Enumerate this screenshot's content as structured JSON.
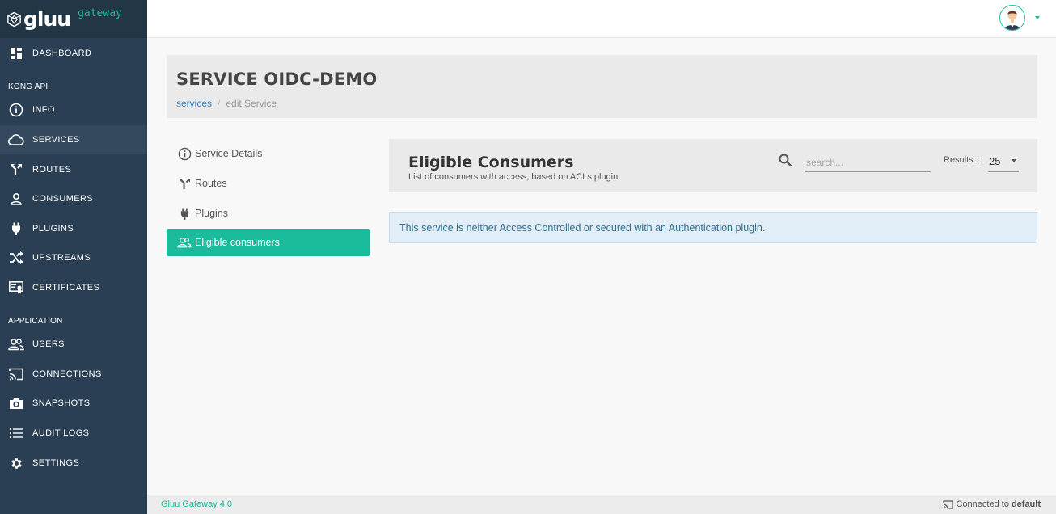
{
  "brand": {
    "name": "gluu",
    "subtitle": "gateway"
  },
  "sidebar": {
    "items": [
      {
        "label": "DASHBOARD",
        "icon": "dashboard-icon"
      },
      {
        "label": "INFO",
        "icon": "info-icon"
      },
      {
        "label": "SERVICES",
        "icon": "cloud-icon",
        "active": true
      },
      {
        "label": "ROUTES",
        "icon": "routes-icon"
      },
      {
        "label": "CONSUMERS",
        "icon": "user-icon"
      },
      {
        "label": "PLUGINS",
        "icon": "plug-icon"
      },
      {
        "label": "UPSTREAMS",
        "icon": "shuffle-icon"
      },
      {
        "label": "CERTIFICATES",
        "icon": "certificate-icon"
      },
      {
        "label": "USERS",
        "icon": "users-icon"
      },
      {
        "label": "CONNECTIONS",
        "icon": "cast-icon"
      },
      {
        "label": "SNAPSHOTS",
        "icon": "camera-icon"
      },
      {
        "label": "AUDIT LOGS",
        "icon": "list-icon"
      },
      {
        "label": "SETTINGS",
        "icon": "gear-icon"
      }
    ],
    "sections": [
      "KONG API",
      "APPLICATION"
    ]
  },
  "header": {
    "title": "SERVICE OIDC-DEMO",
    "breadcrumb": {
      "link": "services",
      "separator": "/",
      "current": "edit Service"
    }
  },
  "subnav": {
    "items": [
      {
        "label": "Service Details",
        "icon": "info-circle-icon"
      },
      {
        "label": "Routes",
        "icon": "routes-icon"
      },
      {
        "label": "Plugins",
        "icon": "plug-icon"
      },
      {
        "label": "Eligible consumers",
        "icon": "users-icon",
        "active": true
      }
    ]
  },
  "consumers": {
    "title": "Eligible Consumers",
    "subtitle": "List of consumers with access, based on ACLs plugin",
    "search_placeholder": "search...",
    "results_label": "Results :",
    "results_value": "25",
    "alert": "This service is neither Access Controlled or secured with an Authentication plugin."
  },
  "footer": {
    "version": "Gluu Gateway 4.0",
    "status_prefix": "Connected to",
    "connection": "default"
  },
  "colors": {
    "sidebar": "#2a3f54",
    "accent": "#1abc9c",
    "alert_bg": "#e1edf7"
  }
}
